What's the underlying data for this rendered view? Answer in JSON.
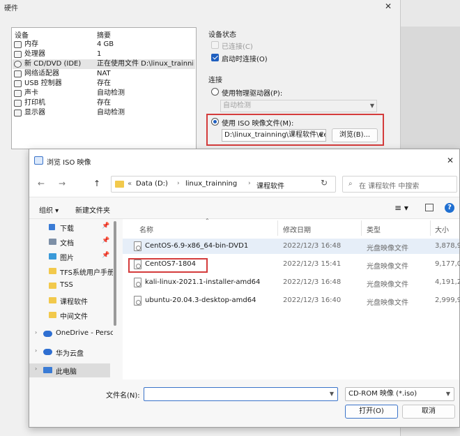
{
  "hardware_dialog": {
    "title": "硬件",
    "close": "✕",
    "device_list": {
      "col_device": "设备",
      "col_summary": "摘要",
      "rows": [
        {
          "name": "内存",
          "summary": "4 GB"
        },
        {
          "name": "处理器",
          "summary": "1"
        },
        {
          "name": "新 CD/DVD (IDE)",
          "summary": "正在使用文件 D:\\linux_trainning\\"
        },
        {
          "name": "网络适配器",
          "summary": "NAT"
        },
        {
          "name": "USB 控制器",
          "summary": "存在"
        },
        {
          "name": "声卡",
          "summary": "自动检测"
        },
        {
          "name": "打印机",
          "summary": "存在"
        },
        {
          "name": "显示器",
          "summary": "自动检测"
        }
      ]
    },
    "device_status": {
      "label": "设备状态",
      "connected": "已连接(C)",
      "connect_at_power_on": "启动时连接(O)"
    },
    "connection": {
      "label": "连接",
      "use_physical": "使用物理驱动器(P):",
      "physical_value": "自动检测",
      "use_iso": "使用 ISO 映像文件(M):",
      "iso_path": "D:\\linux_trainning\\课程软件\\Ce",
      "browse": "浏览(B)..."
    }
  },
  "browse_dialog": {
    "title": "浏览 ISO 映像",
    "close": "✕",
    "nav": {
      "back": "←",
      "forward": "→",
      "up": "↑"
    },
    "breadcrumb": [
      "«",
      "Data (D:)",
      "linux_trainning",
      "课程软件"
    ],
    "search_placeholder": "在 课程软件 中搜索",
    "toolbar": {
      "organize": "组织 ▾",
      "new_folder": "新建文件夹",
      "help": "?"
    },
    "sidebar": [
      {
        "label": "下载",
        "color": "#3a7bd5",
        "pinned": true
      },
      {
        "label": "文档",
        "color": "#7d8fa6",
        "pinned": true
      },
      {
        "label": "图片",
        "color": "#3a9ad9",
        "pinned": true
      },
      {
        "label": "TFS系统用户手册",
        "color": "#f2c94c",
        "pinned": false
      },
      {
        "label": "TSS",
        "color": "#f2c94c",
        "pinned": false
      },
      {
        "label": "课程软件",
        "color": "#f2c94c",
        "pinned": false
      },
      {
        "label": "中间文件",
        "color": "#f2c94c",
        "pinned": false
      },
      {
        "label": "OneDrive - Perso",
        "color": "#2f6fd1",
        "pinned": false
      },
      {
        "label": "华为云盘",
        "color": "#2f6fd1",
        "pinned": false
      },
      {
        "label": "此电脑",
        "color": "#3a7bd5",
        "pinned": false
      }
    ],
    "columns": {
      "name": "名称",
      "date": "修改日期",
      "type": "类型",
      "size": "大小"
    },
    "files": [
      {
        "name": "CentOS-6.9-x86_64-bin-DVD1",
        "date": "2022/12/3 16:48",
        "type": "光盘映像文件",
        "size": "3,878,9"
      },
      {
        "name": "CentOS7-1804",
        "date": "2022/12/3 15:41",
        "type": "光盘映像文件",
        "size": "9,177,0"
      },
      {
        "name": "kali-linux-2021.1-installer-amd64",
        "date": "2022/12/3 16:48",
        "type": "光盘映像文件",
        "size": "4,191,2"
      },
      {
        "name": "ubuntu-20.04.3-desktop-amd64",
        "date": "2022/12/3 16:40",
        "type": "光盘映像文件",
        "size": "2,999,9"
      }
    ],
    "filename_label": "文件名(N):",
    "filename_value": "",
    "filetype_value": "CD-ROM 映像 (*.iso)",
    "open": "打开(O)",
    "cancel": "取消"
  }
}
